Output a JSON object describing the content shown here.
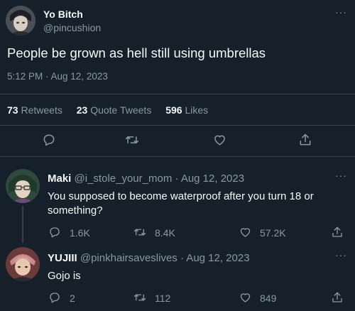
{
  "tweet": {
    "display_name": "Yo Bitch",
    "handle": "@pincushion",
    "text": "People be grown as hell still using umbrellas",
    "timestamp": "5:12 PM · Aug 12, 2023",
    "stats": {
      "retweets_num": "73",
      "retweets_label": "Retweets",
      "quotes_num": "23",
      "quotes_label": "Quote Tweets",
      "likes_num": "596",
      "likes_label": "Likes"
    },
    "actions": [
      "reply-icon",
      "retweet-icon",
      "like-icon",
      "share-icon"
    ],
    "more_glyph": "···"
  },
  "replies": [
    {
      "display_name": "Maki",
      "meta": "@i_stole_your_mom · Aug 12, 2023",
      "text_line1": "You supposed to become waterproof after you turn 18 or",
      "text_line2": "something?",
      "replies": "1.6K",
      "retweets": "8.4K",
      "likes": "57.2K",
      "more_glyph": "···"
    },
    {
      "display_name": "YUJIII",
      "meta": "@pinkhairsaveslives · Aug 12, 2023",
      "text_line1": "Gojo is",
      "replies": "2",
      "retweets": "112",
      "likes": "849",
      "more_glyph": "···"
    }
  ],
  "colors": {
    "background": "#15202b",
    "text": "#f7f9f9",
    "muted": "#8b98a5",
    "divider": "#38444d"
  }
}
